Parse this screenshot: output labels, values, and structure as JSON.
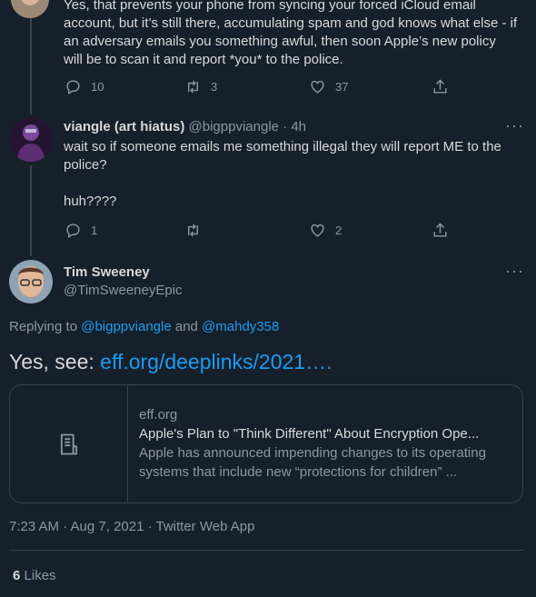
{
  "prev_tweet": {
    "text": "Yes, that prevents your phone from syncing your forced iCloud email account, but it’s still there, accumulating spam and god knows what else - if an adversary emails you something awful, then soon Apple’s new policy will be to scan it and report *you* to the police.",
    "replies": "10",
    "retweets": "3",
    "likes": "37"
  },
  "reply_tweet": {
    "display_name": "viangle (art hiatus)",
    "handle": "@bigppviangle",
    "separator": "·",
    "time": "4h",
    "text": "wait so if someone emails me something illegal they will report ME to the police?\n\nhuh????",
    "replies": "1",
    "retweets": "",
    "likes": "2"
  },
  "main_tweet": {
    "display_name": "Tim Sweeney",
    "handle": "@TimSweeneyEpic",
    "replying_to_label": "Replying to",
    "replying_to_user1": "@bigppviangle",
    "replying_to_and": "and",
    "replying_to_user2": "@mahdy358",
    "text_prefix": "Yes, see:",
    "text_link": "eff.org/deeplinks/2021….",
    "card": {
      "domain": "eff.org",
      "title": "Apple's Plan to \"Think Different\" About Encryption Ope...",
      "description": "Apple has announced impending changes to its operating systems that include new “protections for children” ..."
    },
    "timestamp": "7:23 AM · Aug 7, 2021 · Twitter Web App",
    "likes_count": "6",
    "likes_label": "Likes"
  },
  "colors": {
    "background": "#15202b",
    "text": "#d9d9d9",
    "muted": "#8b98a5",
    "link": "#1d9bf0",
    "border": "#38444d"
  }
}
